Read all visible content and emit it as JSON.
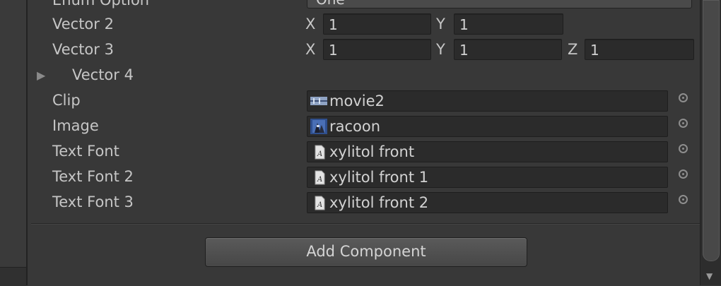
{
  "inspector": {
    "enum_option": {
      "label": "Enum Option",
      "value": "One"
    },
    "vector2": {
      "label": "Vector 2",
      "x_axis": "X",
      "x": "1",
      "y_axis": "Y",
      "y": "1"
    },
    "vector3": {
      "label": "Vector 3",
      "x_axis": "X",
      "x": "1",
      "y_axis": "Y",
      "y": "1",
      "z_axis": "Z",
      "z": "1"
    },
    "vector4": {
      "label": "Vector 4",
      "expanded": false
    },
    "clip": {
      "label": "Clip",
      "value": "movie2",
      "icon": "movie-clip-icon"
    },
    "image": {
      "label": "Image",
      "value": "racoon",
      "icon": "image-thumbnail-icon"
    },
    "text_font": {
      "label": "Text Font",
      "value": "xylitol front",
      "icon": "font-asset-icon"
    },
    "text_font_2": {
      "label": "Text Font 2",
      "value": "xylitol front 1",
      "icon": "font-asset-icon"
    },
    "text_font_3": {
      "label": "Text Font 3",
      "value": "xylitol front 2",
      "icon": "font-asset-icon"
    },
    "add_component_label": "Add Component"
  },
  "colors": {
    "background": "#383838",
    "field": "#2b2b2b",
    "text": "#c6c6c6"
  }
}
